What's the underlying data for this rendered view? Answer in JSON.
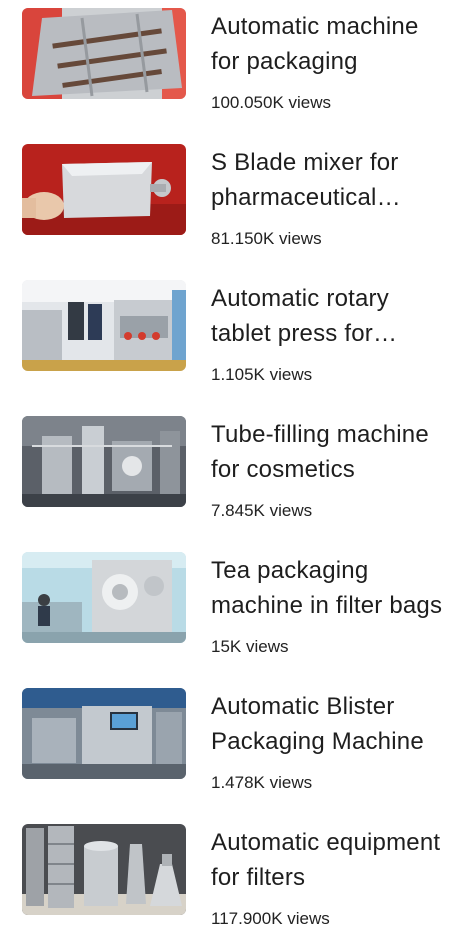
{
  "videos": [
    {
      "title": "Automatic machine for packaging",
      "views": "100.050K views",
      "thumb_icon": "machine-rollers-thumbnail"
    },
    {
      "title": "S Blade mixer for pharmaceutical powders",
      "views": "81.150K views",
      "thumb_icon": "mixer-thumbnail"
    },
    {
      "title": "Automatic rotary tablet press for pharmaceuticals",
      "views": "1.105K views",
      "thumb_icon": "tablet-press-thumbnail"
    },
    {
      "title": "Tube-filling machine for cosmetics",
      "views": "7.845K views",
      "thumb_icon": "tube-filling-thumbnail"
    },
    {
      "title": "Tea packaging machine in filter bags",
      "views": "15K views",
      "thumb_icon": "tea-packaging-thumbnail"
    },
    {
      "title": "Automatic Blister Packaging Machine",
      "views": "1.478K views",
      "thumb_icon": "blister-packaging-thumbnail"
    },
    {
      "title": "Automatic equipment for filters",
      "views": "117.900K views",
      "thumb_icon": "steel-filters-thumbnail"
    }
  ]
}
